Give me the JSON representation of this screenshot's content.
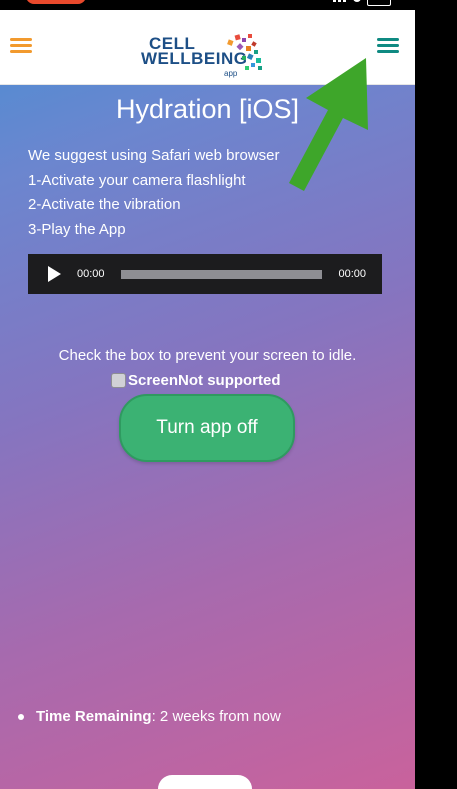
{
  "header": {
    "logo": {
      "line1": "CELL",
      "line2": "WELLBEING",
      "sub": "app"
    },
    "left_menu_icon": "hamburger-menu",
    "right_menu_icon": "hamburger-menu"
  },
  "page": {
    "title": "Hydration [iOS]",
    "intro_lines": [
      "We suggest using Safari web browser",
      "1-Activate your camera flashlight",
      "2-Activate the vibration",
      "3-Play the App"
    ]
  },
  "audio": {
    "current_time": "00:00",
    "duration": "00:00",
    "play_icon": "play-icon"
  },
  "screen": {
    "prevent_text": "Check the box to prevent your screen to idle.",
    "checkbox_label": "ScreenNot supported",
    "checked": false
  },
  "toggle": {
    "label": "Turn app off"
  },
  "remaining": {
    "label": "Time Remaining",
    "value": ": 2 weeks from now"
  },
  "colors": {
    "gradient_start": "#4a8ed3",
    "gradient_end": "#c9629c",
    "button_green": "#3bb273",
    "menu_left": "#f29a2e",
    "menu_right": "#0f8a82",
    "arrow_green": "#3ea62a"
  }
}
